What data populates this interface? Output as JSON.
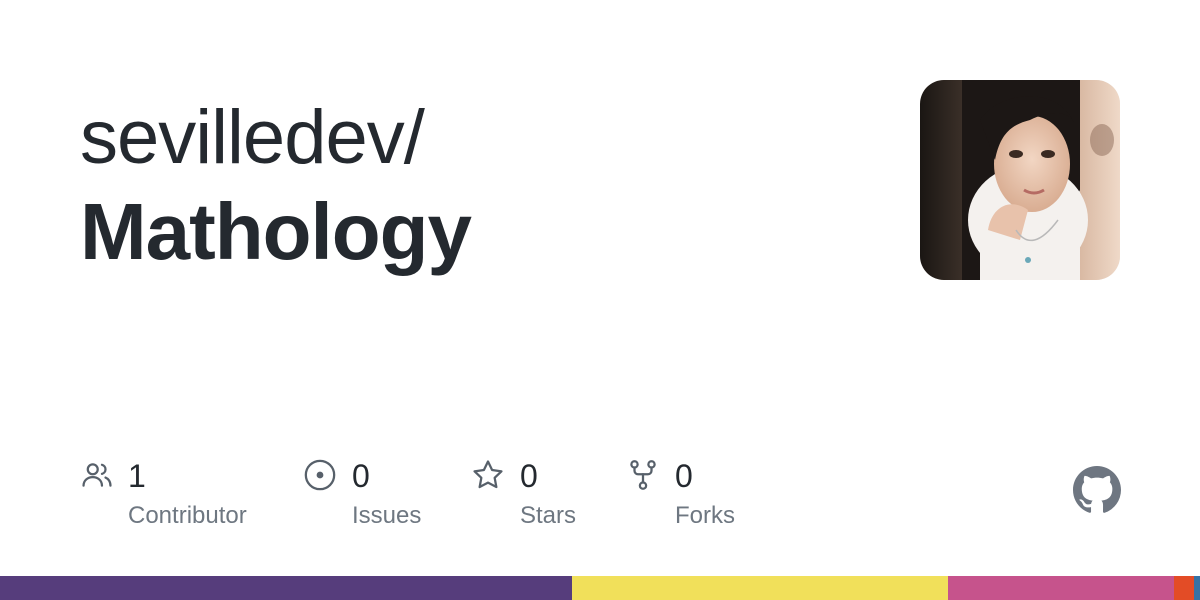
{
  "repo": {
    "owner": "sevilledev/",
    "name": "Mathology"
  },
  "stats": [
    {
      "count": "1",
      "label": "Contributor",
      "icon": "people-icon"
    },
    {
      "count": "0",
      "label": "Issues",
      "icon": "issue-icon"
    },
    {
      "count": "0",
      "label": "Stars",
      "icon": "star-icon"
    },
    {
      "count": "0",
      "label": "Forks",
      "icon": "fork-icon"
    }
  ],
  "colors": {
    "text": "#24292f",
    "muted": "#6e7781",
    "icon": "#57606a",
    "logo": "#6e7681"
  },
  "language_bar": [
    {
      "color": "#563d7c",
      "fraction": 0.4767
    },
    {
      "color": "#f1e05a",
      "fraction": 0.3133
    },
    {
      "color": "#c6538c",
      "fraction": 0.1883
    },
    {
      "color": "#e34c26",
      "fraction": 0.0167
    },
    {
      "color": "#3572a5",
      "fraction": 0.005
    }
  ]
}
